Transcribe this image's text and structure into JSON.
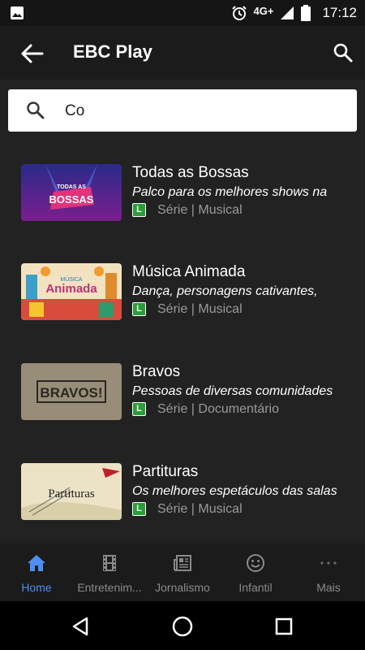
{
  "status_bar": {
    "network": "4G+",
    "time": "17:12"
  },
  "app_bar": {
    "title": "EBC Play"
  },
  "search": {
    "value": "Co"
  },
  "results": [
    {
      "title": "Todas as Bossas",
      "description": "Palco para os melhores shows na",
      "rating": "L",
      "meta": "Série | Musical",
      "thumb_text": "TODAS AS BOSSAS"
    },
    {
      "title": "Música Animada",
      "description": "Dança, personagens cativantes,",
      "rating": "L",
      "meta": "Série | Musical",
      "thumb_text": "Animada"
    },
    {
      "title": "Bravos",
      "description": "Pessoas de diversas comunidades",
      "rating": "L",
      "meta": "Série | Documentário",
      "thumb_text": "BRAVOS!"
    },
    {
      "title": "Partituras",
      "description": "Os melhores espetáculos das salas",
      "rating": "L",
      "meta": "Série | Musical",
      "thumb_text": "Partituras"
    }
  ],
  "bottom_nav": [
    {
      "label": "Home",
      "icon": "home-icon",
      "active": true
    },
    {
      "label": "Entretenim...",
      "icon": "film-icon",
      "active": false
    },
    {
      "label": "Jornalismo",
      "icon": "newspaper-icon",
      "active": false
    },
    {
      "label": "Infantil",
      "icon": "smiley-icon",
      "active": false
    },
    {
      "label": "Mais",
      "icon": "more-icon",
      "active": false
    }
  ],
  "colors": {
    "accent": "#4d8ff0",
    "rating_green": "#2a9d3a",
    "background": "#222222"
  }
}
